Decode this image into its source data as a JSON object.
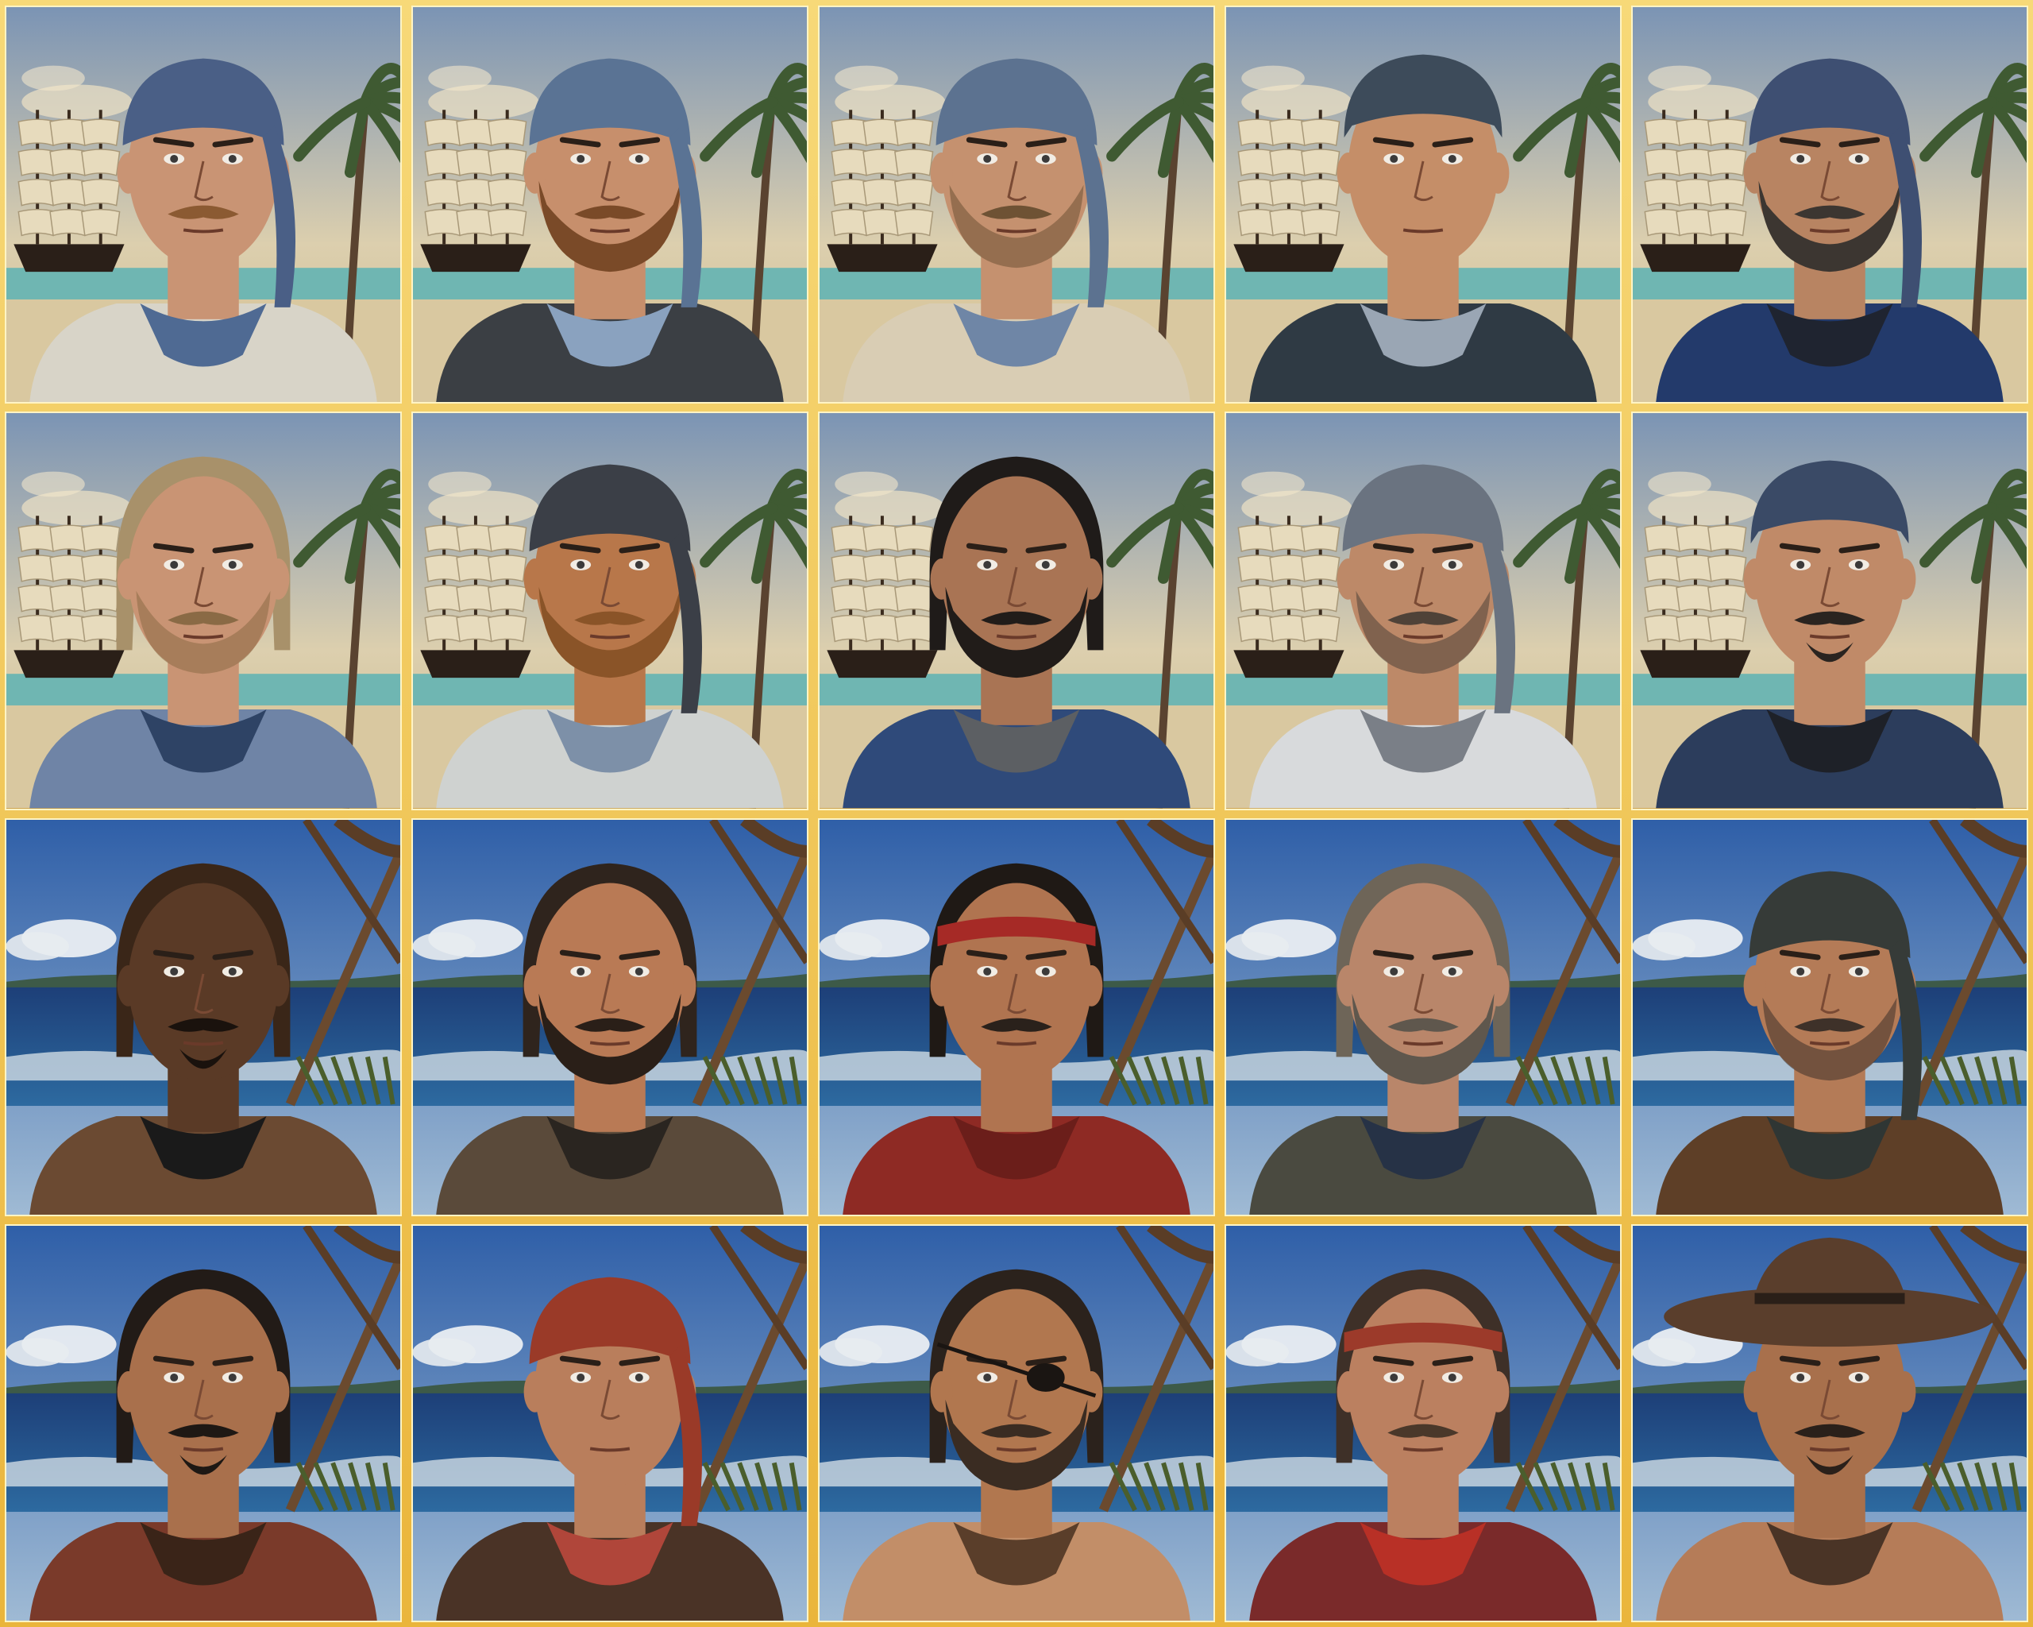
{
  "gallery": {
    "columns": 5,
    "rows": 4,
    "frame_color": "#f3c24a",
    "portraits": [
      {
        "scene": "ship",
        "skin": "#c99474",
        "hair": "#8a6a45",
        "headwear": "bandana",
        "headwear_color": "#4a5f86",
        "beard": "mustache",
        "beard_color": "#8b5a32",
        "shirt": "#d8d4c8",
        "neck": "#4f6a93",
        "eyepatch": false
      },
      {
        "scene": "ship",
        "skin": "#c78f6c",
        "hair": "#6a4a2e",
        "headwear": "bandana",
        "headwear_color": "#5a7394",
        "beard": "full",
        "beard_color": "#7a4a28",
        "shirt": "#3b3f44",
        "neck": "#8aa2bf",
        "eyepatch": false
      },
      {
        "scene": "ship",
        "skin": "#c5916f",
        "hair": "#7a6242",
        "headwear": "bandana",
        "headwear_color": "#5c7290",
        "beard": "stubble",
        "beard_color": "#6e5234",
        "shirt": "#d9cdb4",
        "neck": "#6f86a6",
        "eyepatch": false
      },
      {
        "scene": "ship",
        "skin": "#c58e68",
        "hair": "#a08057",
        "headwear": "cap",
        "headwear_color": "#3d4b5a",
        "beard": "none",
        "beard_color": "#6e5234",
        "shirt": "#2f3a44",
        "neck": "#9aa6b4",
        "eyepatch": false
      },
      {
        "scene": "ship",
        "skin": "#b88462",
        "hair": "#4a3b30",
        "headwear": "bandana",
        "headwear_color": "#3e4f72",
        "beard": "full",
        "beard_color": "#3c3631",
        "shirt": "#233a6b",
        "neck": "#1f2430",
        "eyepatch": false
      },
      {
        "scene": "ship",
        "skin": "#c99474",
        "hair": "#a8916a",
        "headwear": "none",
        "headwear_color": "#a8916a",
        "beard": "stubble",
        "beard_color": "#8a6a45",
        "shirt": "#6f84a6",
        "neck": "#2e4365",
        "eyepatch": false
      },
      {
        "scene": "ship",
        "skin": "#b8774a",
        "hair": "#3d3028",
        "headwear": "bandana",
        "headwear_color": "#3b3f47",
        "beard": "full",
        "beard_color": "#8a5428",
        "shirt": "#cfd2d0",
        "neck": "#7d90a8",
        "eyepatch": false
      },
      {
        "scene": "ship",
        "skin": "#a97454",
        "hair": "#1f1b19",
        "headwear": "none",
        "headwear_color": "#1f1b19",
        "beard": "full",
        "beard_color": "#211c19",
        "shirt": "#2f4a7a",
        "neck": "#5c5f63",
        "eyepatch": false
      },
      {
        "scene": "ship",
        "skin": "#bd8968",
        "hair": "#4a4038",
        "headwear": "bandana",
        "headwear_color": "#6a7380",
        "beard": "stubble",
        "beard_color": "#4f4238",
        "shirt": "#d8dadc",
        "neck": "#7a7f87",
        "eyepatch": false
      },
      {
        "scene": "ship",
        "skin": "#c08a68",
        "hair": "#3a3630",
        "headwear": "cap",
        "headwear_color": "#3a4a66",
        "beard": "goatee",
        "beard_color": "#2a2420",
        "shirt": "#2c3d5c",
        "neck": "#1e2128",
        "eyepatch": false
      },
      {
        "scene": "sea",
        "skin": "#5a3a26",
        "hair": "#3a2618",
        "headwear": "none",
        "headwear_color": "#5a3a26",
        "beard": "goatee",
        "beard_color": "#1a120d",
        "shirt": "#6b4a32",
        "neck": "#1a1a1a",
        "eyepatch": false
      },
      {
        "scene": "sea",
        "skin": "#b97a55",
        "hair": "#2f241d",
        "headwear": "none",
        "headwear_color": "#2f241d",
        "beard": "full",
        "beard_color": "#2a1f18",
        "shirt": "#5a4a3a",
        "neck": "#2a2520",
        "eyepatch": false
      },
      {
        "scene": "sea",
        "skin": "#b07450",
        "hair": "#1f1915",
        "headwear": "headband",
        "headwear_color": "#a62a26",
        "beard": "mustache",
        "beard_color": "#2a211b",
        "shirt": "#8e2a24",
        "neck": "#6b1e1a",
        "eyepatch": false
      },
      {
        "scene": "sea",
        "skin": "#b9866a",
        "hair": "#6e6558",
        "headwear": "none",
        "headwear_color": "#6e6558",
        "beard": "full",
        "beard_color": "#5f574d",
        "shirt": "#4a4a40",
        "neck": "#263246",
        "eyepatch": false
      },
      {
        "scene": "sea",
        "skin": "#b47b57",
        "hair": "#3c352e",
        "headwear": "bandana",
        "headwear_color": "#363b38",
        "beard": "stubble",
        "beard_color": "#3e3129",
        "shirt": "#5e3f27",
        "neck": "#2f3634",
        "eyepatch": false
      },
      {
        "scene": "sea",
        "skin": "#a9704c",
        "hair": "#221b17",
        "headwear": "none",
        "headwear_color": "#221b17",
        "beard": "goatee",
        "beard_color": "#1e1814",
        "shirt": "#7a3a2a",
        "neck": "#3a2418",
        "eyepatch": false
      },
      {
        "scene": "sea",
        "skin": "#b97e5c",
        "hair": "#5a4636",
        "headwear": "bandana",
        "headwear_color": "#9a3a28",
        "beard": "none",
        "beard_color": "#4a3a2c",
        "shirt": "#4a3326",
        "neck": "#b0463a",
        "eyepatch": false
      },
      {
        "scene": "sea",
        "skin": "#b1774f",
        "hair": "#2b221c",
        "headwear": "none",
        "headwear_color": "#2b221c",
        "beard": "full",
        "beard_color": "#3a2c22",
        "shirt": "#c28e68",
        "neck": "#5a3e2a",
        "eyepatch": true
      },
      {
        "scene": "sea",
        "skin": "#bb8060",
        "hair": "#3e3028",
        "headwear": "headband",
        "headwear_color": "#9c3a2a",
        "beard": "mustache",
        "beard_color": "#4a382a",
        "shirt": "#7a2a2a",
        "neck": "#b83026",
        "eyepatch": false
      },
      {
        "scene": "sea",
        "skin": "#a8704c",
        "hair": "#231c18",
        "headwear": "hat",
        "headwear_color": "#5a3e2c",
        "beard": "goatee",
        "beard_color": "#2a201a",
        "shirt": "#b57c58",
        "neck": "#4a3426",
        "eyepatch": false
      }
    ]
  }
}
